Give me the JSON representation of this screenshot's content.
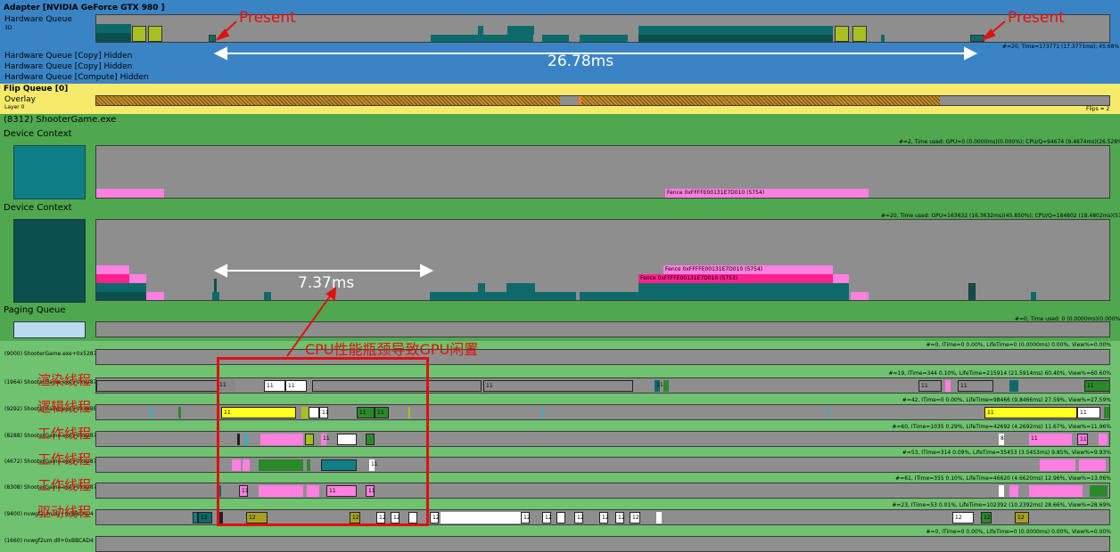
{
  "adapter": {
    "title": "Adapter [NVIDIA GeForce GTX 980     ]",
    "hw_queue_label": "Hardware Queue",
    "hw_queue_sub": "3D",
    "hw_stats": "#=20, Time=173771 (17.3771ms), 45.68%",
    "copy1": "Hardware Queue [Copy] Hidden",
    "copy2": "Hardware Queue [Copy] Hidden",
    "compute": "Hardware Queue [Compute] Hidden"
  },
  "flip": {
    "title": "Flip Queue [0]",
    "overlay": "Overlay",
    "layer": "Layer 0",
    "flips": "Flips = 2"
  },
  "process": {
    "title": "(8312) ShooterGame.exe",
    "ctx1_label": "Device Context",
    "ctx1_stats": "#=2, Time used: GPU=0 (0.0000ms)(0.000%); CPU/Q=94674 (9.4674ms)(26.528%)",
    "ctx1_fence": "Fence 0xFFFFE00131E7D010 (5754)",
    "ctx2_label": "Device Context",
    "ctx2_stats": "#=20, Time used: GPU=163632 (16.3632ms)(45.850%); CPU/Q=184802 (18.4802ms)(51.782%)",
    "ctx2_fence1": "Fence 0xFFFFE00131E7D010 (5754)",
    "ctx2_fence2": "Fence 0xFFFFE00131E7D010 (5753)",
    "paging_label": "Paging Queue",
    "paging_stats": "#=0, Time used: 0 (0.0000ms)(0.000%)"
  },
  "threads": [
    {
      "label": "(9000) ShooterGame.exe+0x528780",
      "stats": "#=0, ITime=0  0.00%, LifeTime=0 (0.0000ms)  0.00%, View%=0.00%",
      "cn": ""
    },
    {
      "label": "(1964) ShooterGame.exe+0x528780",
      "stats": "#=19, ITime=344  0.10%, LifeTime=215914 (21.5914ms)  60.40%, View%=60.60%",
      "cn": "渲染线程"
    },
    {
      "label": "(9292) ShooterGame.exe+0x388E554",
      "stats": "#=42, ITime=0  0.00%, LifeTime=98466 (9.8466ms)  27.59%, View%=27.59%",
      "cn": "逻辑线程"
    },
    {
      "label": "(8288) ShooterGame.exe+0x528780",
      "stats": "#=60, ITime=1035  0.29%, LifeTime=42692 (4.2692ms)  11.67%, View%=11.96%",
      "cn": "工作线程"
    },
    {
      "label": "(4672) ShooterGame.exe+0x528780",
      "stats": "#=53, ITime=314  0.09%, LifeTime=35453 (3.5453ms)  9.85%, View%=9.93%",
      "cn": "工作线程"
    },
    {
      "label": "(8308) ShooterGame.exe+0x528780",
      "stats": "#=61, ITime=355  0.10%, LifeTime=46620 (4.6620ms)  12.96%, View%=13.06%",
      "cn": "工作线程"
    },
    {
      "label": "(9400) nvwgf2um.dll+0xBBCAD4",
      "stats": "#=23, ITime=53  0.01%, LifeTime=102392 (10.2392ms)  28.66%, View%=28.69%",
      "cn": "驱动线程"
    },
    {
      "label": "(1660) nvwgf2um.dll+0xBBCAD4",
      "stats": "#=0, ITime=0  0.00%, LifeTime=0 (0.0000ms)  0.00%, View%=0.00%",
      "cn": ""
    }
  ],
  "annotations": {
    "present_left": "Present",
    "present_right": "Present",
    "frame_time": "26.78ms",
    "gap_time": "7.37ms",
    "bottleneck": "CPU性能瓶颈导致GPU闲置"
  },
  "packet_labels": [
    "11",
    "12",
    "8"
  ],
  "colors": {
    "adapter_bg": "#3a84c6",
    "flip_bg": "#f5ea6a",
    "process_bg": "#4fa84f",
    "thread_bg": "#6fc26f",
    "track": "#8e8e8e",
    "teal": "#0e6a6a",
    "teal_dark": "#0b4f4f",
    "pink": "#ff80e0",
    "hot_pink": "#ff2090",
    "olive": "#a8c020",
    "yellow": "#ffff20",
    "hatch": "#c8902a",
    "red_annot": "#e01010"
  }
}
